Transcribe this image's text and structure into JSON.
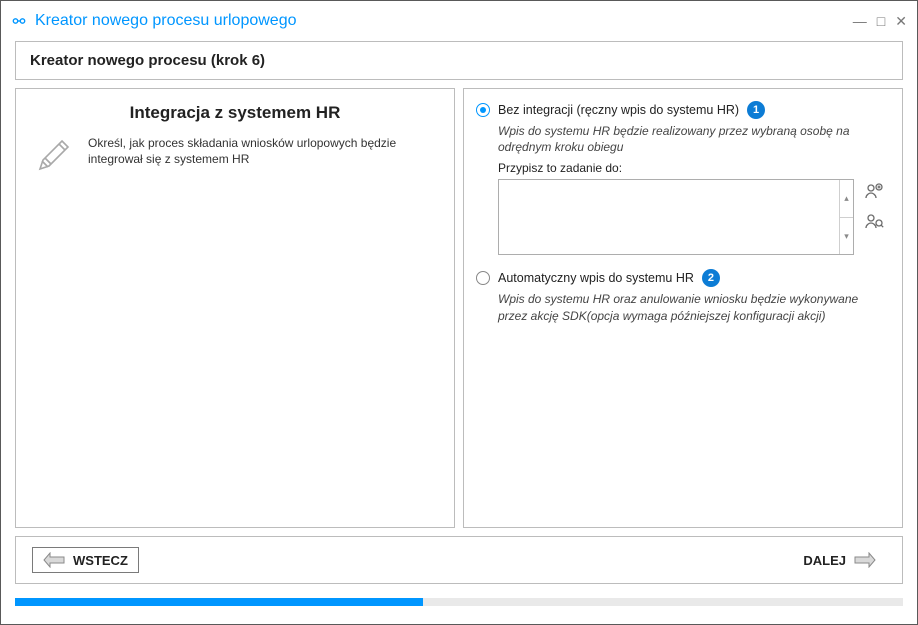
{
  "window": {
    "title": "Kreator nowego procesu urlopowego"
  },
  "step_header": "Kreator nowego procesu (krok 6)",
  "left": {
    "title": "Integracja z systemem HR",
    "description": "Określ, jak proces składania wniosków urlopowych będzie integrował się z systemem HR"
  },
  "options": {
    "opt1": {
      "label": "Bez integracji (ręczny wpis do systemu HR)",
      "badge": "1",
      "description": "Wpis do systemu HR będzie realizowany przez wybraną osobę na odrędnym kroku obiegu",
      "assign_label": "Przypisz to zadanie do:",
      "selected": true
    },
    "opt2": {
      "label": "Automatyczny wpis do systemu HR",
      "badge": "2",
      "description": "Wpis do systemu HR oraz anulowanie wniosku będzie wykonywane przez akcję SDK(opcja wymaga późniejszej konfiguracji akcji)",
      "selected": false
    }
  },
  "footer": {
    "back": "WSTECZ",
    "next": "DALEJ"
  },
  "progress_percent": 46
}
